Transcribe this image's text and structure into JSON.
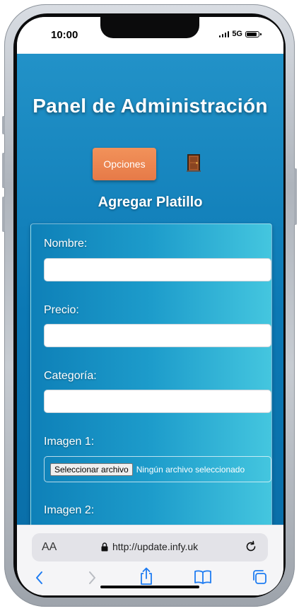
{
  "status": {
    "time": "10:00",
    "network": "5G"
  },
  "header": {
    "title": "Panel de Administración"
  },
  "toolbar": {
    "options_label": "Opciones",
    "logout_icon": "door-icon"
  },
  "form": {
    "section_title": "Agregar Platillo",
    "fields": {
      "nombre": {
        "label": "Nombre:",
        "value": ""
      },
      "precio": {
        "label": "Precio:",
        "value": ""
      },
      "categoria": {
        "label": "Categoría:",
        "value": ""
      },
      "imagen1": {
        "label": "Imagen 1:",
        "button": "Seleccionar archivo",
        "status": "Ningún archivo seleccionado"
      },
      "imagen2": {
        "label": "Imagen 2:"
      }
    }
  },
  "browser": {
    "text_size_label": "AA",
    "url": "http://update.infy.uk",
    "icons": [
      "lock-icon",
      "reload-icon",
      "back-icon",
      "forward-icon",
      "share-icon",
      "bookmarks-icon",
      "tabs-icon"
    ]
  },
  "colors": {
    "accent": "#ee8752",
    "background": "#0b78b4",
    "ios_blue": "#1e7cf2"
  }
}
